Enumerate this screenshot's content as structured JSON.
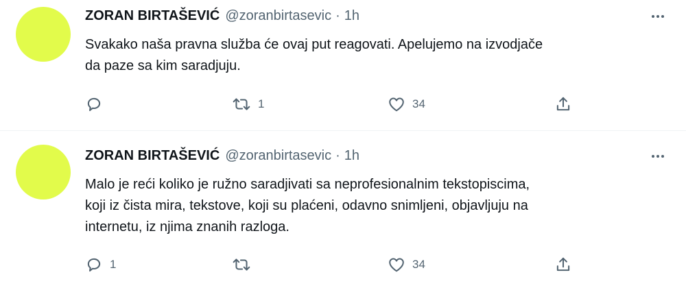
{
  "tweets": [
    {
      "author": "ZORAN BIRTAŠEVIĆ",
      "handle": "@zoranbirtasevic",
      "separator": "·",
      "time": "1h",
      "text_lines": [
        "Svakako naša pravna služba će ovaj put reagovati. Apelujemo na izvodjače",
        "da paze sa kim saradjuju."
      ],
      "replies": "",
      "retweets": "1",
      "likes": "34"
    },
    {
      "author": "ZORAN BIRTAŠEVIĆ",
      "handle": "@zoranbirtasevic",
      "separator": "·",
      "time": "1h",
      "text_lines": [
        "Malo je reći koliko je ružno saradjivati sa neprofesionalnim tekstopiscima,",
        "koji iz čista mira, tekstove, koji su plaćeni, odavno snimljeni, objavljuju na",
        "internetu, iz njima znanih razloga."
      ],
      "replies": "1",
      "retweets": "",
      "likes": "34"
    }
  ],
  "colors": {
    "avatar": "#e2fb4b",
    "text_primary": "#0f1419",
    "text_secondary": "#536471",
    "divider": "#eff3f4"
  },
  "icons": [
    "more-icon",
    "reply-icon",
    "retweet-icon",
    "like-icon",
    "share-icon"
  ]
}
